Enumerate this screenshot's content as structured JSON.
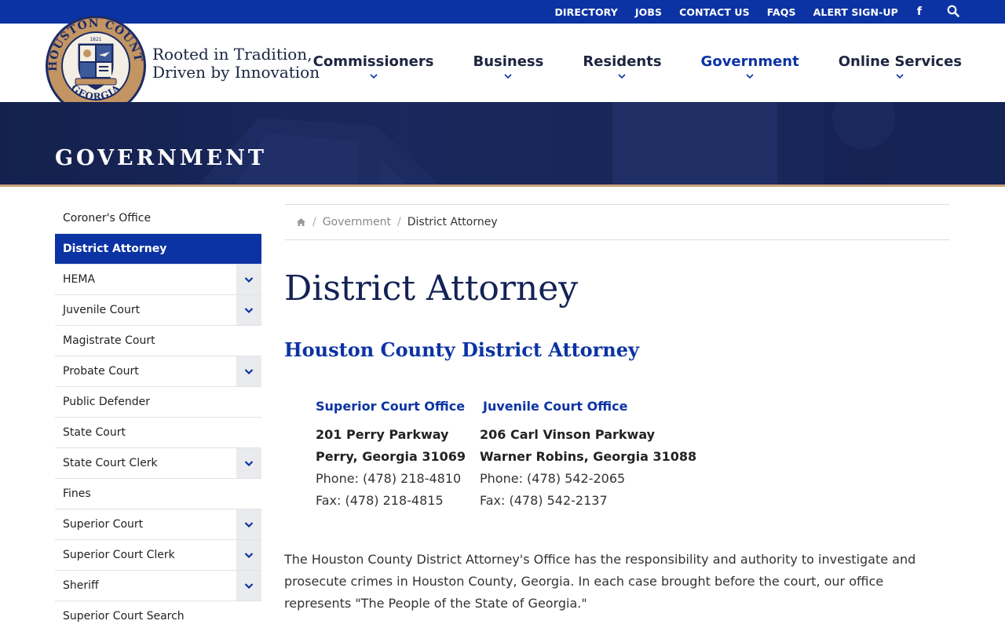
{
  "topbar": {
    "links": [
      "DIRECTORY",
      "JOBS",
      "CONTACT US",
      "FAQS",
      "ALERT SIGN-UP"
    ],
    "facebook_icon": "facebook-icon",
    "search_icon": "search-icon"
  },
  "header": {
    "seal": {
      "top_text": "HOUSTON COUNTY",
      "bottom_text": "GEORGIA",
      "year": "1821"
    },
    "tagline_line1": "Rooted in Tradition,",
    "tagline_line2": "Driven by Innovation"
  },
  "nav": {
    "items": [
      {
        "label": "Commissioners"
      },
      {
        "label": "Business"
      },
      {
        "label": "Residents"
      },
      {
        "label": "Government"
      },
      {
        "label": "Online Services"
      }
    ],
    "active": "Government"
  },
  "hero": {
    "title": "GOVERNMENT"
  },
  "sidebar": {
    "items": [
      {
        "label": "Coroner's Office"
      },
      {
        "label": "District Attorney"
      },
      {
        "label": "HEMA"
      },
      {
        "label": "Juvenile Court"
      },
      {
        "label": "Magistrate Court"
      },
      {
        "label": "Probate Court"
      },
      {
        "label": "Public Defender"
      },
      {
        "label": "State Court"
      },
      {
        "label": "State Court Clerk"
      },
      {
        "label": "Fines"
      },
      {
        "label": "Superior Court"
      },
      {
        "label": "Superior Court Clerk"
      },
      {
        "label": "Sheriff"
      },
      {
        "label": "Superior Court Search"
      }
    ]
  },
  "breadcrumb": {
    "home_icon": "home-icon",
    "parent": "Government",
    "current": "District Attorney"
  },
  "main": {
    "title": "District Attorney",
    "subtitle": "Houston County District Attorney",
    "offices": [
      {
        "heading": "Superior Court Office",
        "address1": "201 Perry Parkway",
        "address2": "Perry, Georgia 31069",
        "phone": "Phone: (478) 218-4810",
        "fax": "Fax: (478) 218-4815"
      },
      {
        "heading": "Juvenile Court Office",
        "address1": "206 Carl Vinson Parkway",
        "address2": "Warner Robins, Georgia 31088",
        "phone": "Phone: (478) 542-2065",
        "fax": "Fax: (478) 542-2137"
      }
    ],
    "description": "The Houston County District Attorney's Office has the responsibility and authority to investigate and prosecute crimes in Houston County, Georgia.  In each case brought before the court, our office represents \"The People of the State of Georgia.\""
  },
  "colors": {
    "brand_blue": "#0b33a3",
    "navy": "#142255",
    "accent_gold": "#c8a27a"
  }
}
